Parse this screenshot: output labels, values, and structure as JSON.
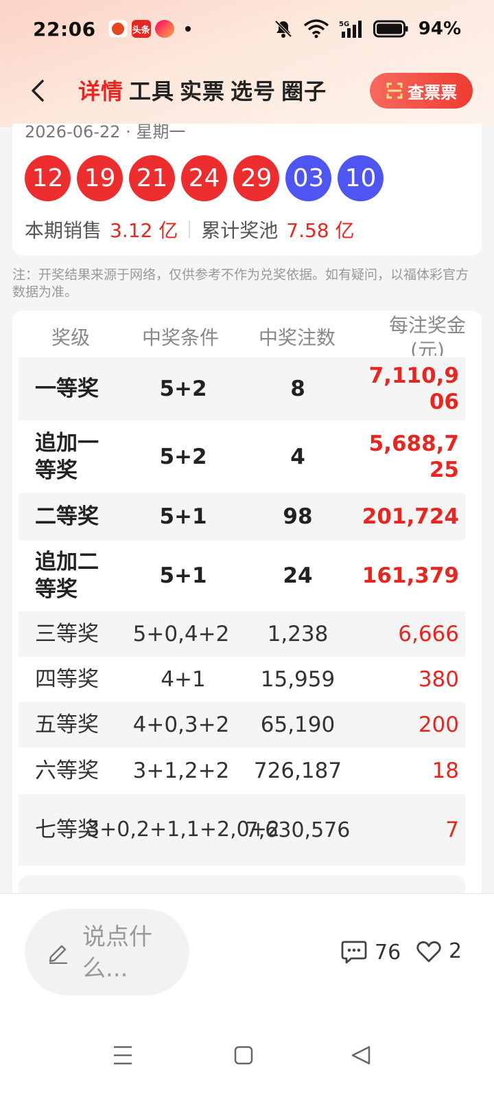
{
  "status": {
    "time": "22:06",
    "battery": "94%",
    "app_badge": "头条"
  },
  "header": {
    "tabs": [
      "详情",
      "工具",
      "实票",
      "选号",
      "圈子"
    ],
    "check_button": "查票票"
  },
  "draw": {
    "date": "2026-06-22",
    "weekday": "星期一",
    "red_balls": [
      "12",
      "19",
      "21",
      "24",
      "29"
    ],
    "blue_balls": [
      "03",
      "10"
    ],
    "sales_label": "本期销售",
    "sales_value": "3.12 亿",
    "pool_label": "累计奖池",
    "pool_value": "7.58 亿"
  },
  "note": "注：开奖结果来源于网络，仅供参考不作为兑奖依据。如有疑问，以福体彩官方数据为准。",
  "table": {
    "headers": [
      "奖级",
      "中奖条件",
      "中奖注数",
      "每注奖金(元)"
    ],
    "rows": [
      {
        "level": "一等奖",
        "condition": "5+2",
        "count": "8",
        "prize": "7,110,906"
      },
      {
        "level": "追加一等奖",
        "condition": "5+2",
        "count": "4",
        "prize": "5,688,725"
      },
      {
        "level": "二等奖",
        "condition": "5+1",
        "count": "98",
        "prize": "201,724"
      },
      {
        "level": "追加二等奖",
        "condition": "5+1",
        "count": "24",
        "prize": "161,379"
      },
      {
        "level": "三等奖",
        "condition": "5+0,4+2",
        "count": "1,238",
        "prize": "6,666"
      },
      {
        "level": "四等奖",
        "condition": "4+1",
        "count": "15,959",
        "prize": "380"
      },
      {
        "level": "五等奖",
        "condition": "4+0,3+2",
        "count": "65,190",
        "prize": "200"
      },
      {
        "level": "六等奖",
        "condition": "3+1,2+2",
        "count": "726,187",
        "prize": "18"
      },
      {
        "level": "七等奖",
        "condition": "3+0,2+1,1+2,0+2",
        "count": "7,630,576",
        "prize": "7"
      }
    ]
  },
  "bottom": {
    "comment_placeholder": "说点什么...",
    "comment_count": "76",
    "like_count": "2"
  }
}
